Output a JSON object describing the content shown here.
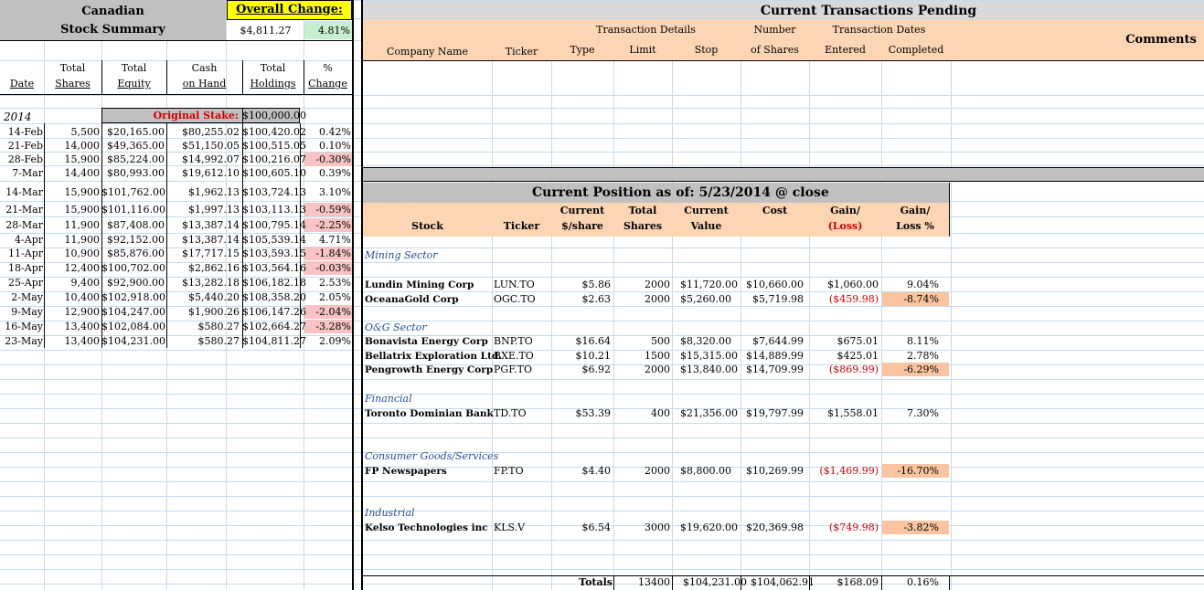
{
  "summary": {
    "title_line1": "Canadian",
    "title_line2": "Stock Summary",
    "overall_change_label": "Overall Change:",
    "overall_change_amount": "$4,811.27",
    "overall_change_pct": "4.81%",
    "col_headers": [
      {
        "l1": "",
        "l2": "Date"
      },
      {
        "l1": "Total",
        "l2": "Shares"
      },
      {
        "l1": "Total",
        "l2": "Equity"
      },
      {
        "l1": "Cash",
        "l2": "on Hand"
      },
      {
        "l1": "Total",
        "l2": "Holdings"
      },
      {
        "l1": "%",
        "l2": "Change"
      }
    ],
    "year": "2014",
    "original_stake_label": "Original Stake:",
    "original_stake_value": "$100,000.00",
    "rows": [
      {
        "date": "14-Feb",
        "shares": "5,500",
        "equity": "$20,165.00",
        "cash": "$80,255.02",
        "holdings": "$100,420.02",
        "change": "0.42%",
        "neg": false
      },
      {
        "date": "21-Feb",
        "shares": "14,000",
        "equity": "$49,365.00",
        "cash": "$51,150.05",
        "holdings": "$100,515.05",
        "change": "0.10%",
        "neg": false
      },
      {
        "date": "28-Feb",
        "shares": "15,900",
        "equity": "$85,224.00",
        "cash": "$14,992.07",
        "holdings": "$100,216.07",
        "change": "-0.30%",
        "neg": true
      },
      {
        "date": "7-Mar",
        "shares": "14,400",
        "equity": "$80,993.00",
        "cash": "$19,612.10",
        "holdings": "$100,605.10",
        "change": "0.39%",
        "neg": false
      },
      {
        "date": "14-Mar",
        "shares": "15,900",
        "equity": "$101,762.00",
        "cash": "$1,962.13",
        "holdings": "$103,724.13",
        "change": "3.10%",
        "neg": false
      },
      {
        "date": "21-Mar",
        "shares": "15,900",
        "equity": "$101,116.00",
        "cash": "$1,997.13",
        "holdings": "$103,113.13",
        "change": "-0.59%",
        "neg": true
      },
      {
        "date": "28-Mar",
        "shares": "11,900",
        "equity": "$87,408.00",
        "cash": "$13,387.14",
        "holdings": "$100,795.14",
        "change": "-2.25%",
        "neg": true
      },
      {
        "date": "4-Apr",
        "shares": "11,900",
        "equity": "$92,152.00",
        "cash": "$13,387.14",
        "holdings": "$105,539.14",
        "change": "4.71%",
        "neg": false
      },
      {
        "date": "11-Apr",
        "shares": "10,900",
        "equity": "$85,876.00",
        "cash": "$17,717.15",
        "holdings": "$103,593.15",
        "change": "-1.84%",
        "neg": true
      },
      {
        "date": "18-Apr",
        "shares": "12,400",
        "equity": "$100,702.00",
        "cash": "$2,862.16",
        "holdings": "$103,564.16",
        "change": "-0.03%",
        "neg": true
      },
      {
        "date": "25-Apr",
        "shares": "9,400",
        "equity": "$92,900.00",
        "cash": "$13,282.18",
        "holdings": "$106,182.18",
        "change": "2.53%",
        "neg": false
      },
      {
        "date": "2-May",
        "shares": "10,400",
        "equity": "$102,918.00",
        "cash": "$5,440.20",
        "holdings": "$108,358.20",
        "change": "2.05%",
        "neg": false
      },
      {
        "date": "9-May",
        "shares": "12,900",
        "equity": "$104,247.00",
        "cash": "$1,900.26",
        "holdings": "$106,147.26",
        "change": "-2.04%",
        "neg": true
      },
      {
        "date": "16-May",
        "shares": "13,400",
        "equity": "$102,084.00",
        "cash": "$580.27",
        "holdings": "$102,664.27",
        "change": "-3.28%",
        "neg": true
      },
      {
        "date": "23-May",
        "shares": "13,400",
        "equity": "$104,231.00",
        "cash": "$580.27",
        "holdings": "$104,811.27",
        "change": "2.09%",
        "neg": false
      }
    ]
  },
  "pending": {
    "title": "Current Transactions Pending",
    "group_transaction_details": "Transaction Details",
    "group_number": "Number",
    "group_dates": "Transaction Dates",
    "comments": "Comments",
    "cols": [
      "Company Name",
      "Ticker",
      "Type",
      "Limit",
      "Stop",
      "of Shares",
      "Entered",
      "Completed"
    ]
  },
  "position": {
    "title": "Current Position as of: 5/23/2014  @ close",
    "cols": [
      {
        "l1": "",
        "l2": "Stock"
      },
      {
        "l1": "",
        "l2": "Ticker"
      },
      {
        "l1": "Current",
        "l2": "$/share"
      },
      {
        "l1": "Total",
        "l2": "Shares"
      },
      {
        "l1": "Current",
        "l2": "Value"
      },
      {
        "l1": "Cost",
        "l2": ""
      },
      {
        "l1": "Gain/",
        "l2": "(Loss)"
      },
      {
        "l1": "Gain/",
        "l2": "Loss %"
      }
    ],
    "sections": [
      {
        "name": "Mining Sector",
        "stocks": [
          {
            "stock": "Lundin Mining Corp",
            "ticker": "LUN.TO",
            "price": "$5.86",
            "shares": "2000",
            "value": "$11,720.00",
            "cost": "$10,660.00",
            "gain": "$1,060.00",
            "pct": "9.04%",
            "neg": false
          },
          {
            "stock": "OceanaGold Corp",
            "ticker": "OGC.TO",
            "price": "$2.63",
            "shares": "2000",
            "value": "$5,260.00",
            "cost": "$5,719.98",
            "gain": "($459.98)",
            "pct": "-8.74%",
            "neg": true
          }
        ]
      },
      {
        "name": "O&G Sector",
        "stocks": [
          {
            "stock": "Bonavista Energy Corp",
            "ticker": "BNP.TO",
            "price": "$16.64",
            "shares": "500",
            "value": "$8,320.00",
            "cost": "$7,644.99",
            "gain": "$675.01",
            "pct": "8.11%",
            "neg": false
          },
          {
            "stock": "Bellatrix Exploration Ltd.",
            "ticker": "BXE.TO",
            "price": "$10.21",
            "shares": "1500",
            "value": "$15,315.00",
            "cost": "$14,889.99",
            "gain": "$425.01",
            "pct": "2.78%",
            "neg": false
          },
          {
            "stock": "Pengrowth Energy Corp",
            "ticker": "PGF.TO",
            "price": "$6.92",
            "shares": "2000",
            "value": "$13,840.00",
            "cost": "$14,709.99",
            "gain": "($869.99)",
            "pct": "-6.29%",
            "neg": true
          }
        ]
      },
      {
        "name": "Financial",
        "stocks": [
          {
            "stock": "Toronto Dominian Bank",
            "ticker": "TD.TO",
            "price": "$53.39",
            "shares": "400",
            "value": "$21,356.00",
            "cost": "$19,797.99",
            "gain": "$1,558.01",
            "pct": "7.30%",
            "neg": false
          }
        ]
      },
      {
        "name": "Consumer Goods/Services",
        "stocks": [
          {
            "stock": "FP Newspapers",
            "ticker": "FP.TO",
            "price": "$4.40",
            "shares": "2000",
            "value": "$8,800.00",
            "cost": "$10,269.99",
            "gain": "($1,469.99)",
            "pct": "-16.70%",
            "neg": true
          }
        ]
      },
      {
        "name": "Industrial",
        "stocks": [
          {
            "stock": "Kelso Technologies inc",
            "ticker": "KLS.V",
            "price": "$6.54",
            "shares": "3000",
            "value": "$19,620.00",
            "cost": "$20,369.98",
            "gain": "($749.98)",
            "pct": "-3.82%",
            "neg": true
          }
        ]
      }
    ],
    "totals": {
      "label": "Totals",
      "shares": "13400",
      "value": "$104,231.00",
      "cost": "$104,062.91",
      "gain": "$168.09",
      "pct": "0.16%"
    }
  }
}
